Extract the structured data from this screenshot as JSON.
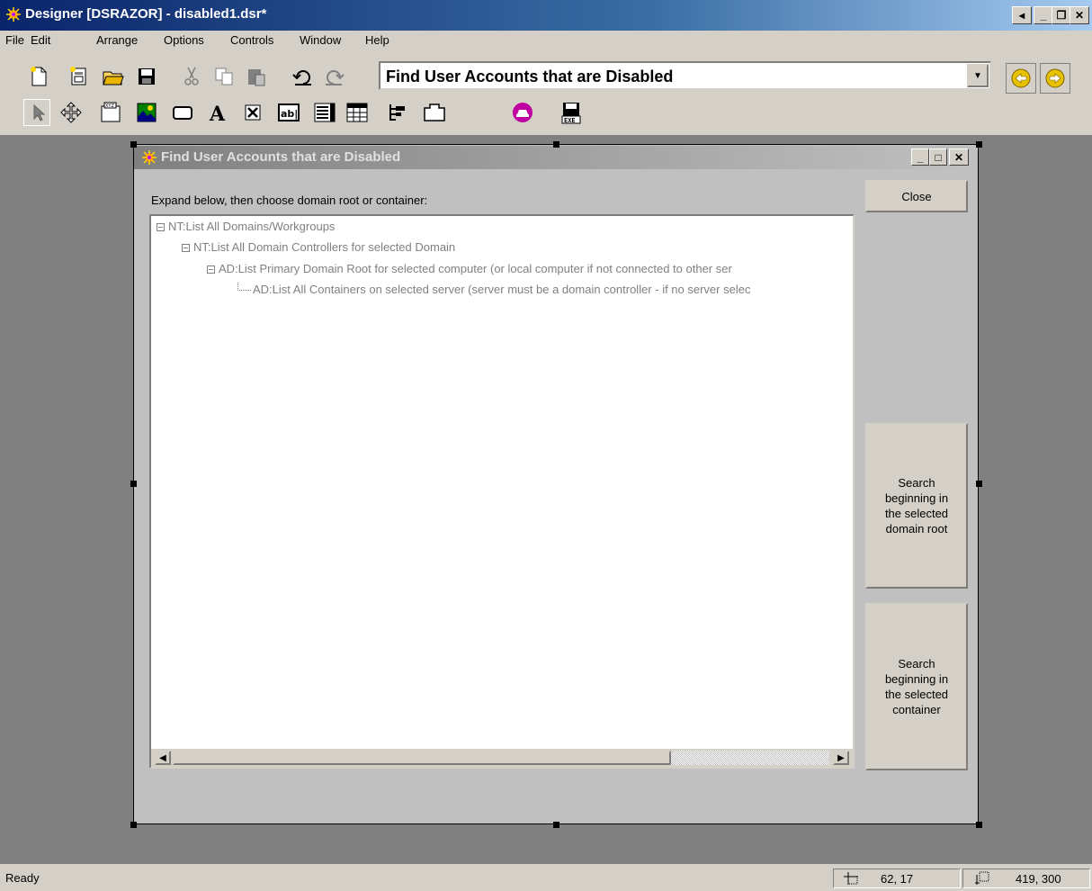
{
  "window": {
    "title": "Designer [DSRAZOR] - disabled1.dsr*",
    "app_icon": "designer-app-icon",
    "caption_buttons": [
      "restore-prev-icon",
      "minimize-icon",
      "maximize-icon",
      "close-icon"
    ]
  },
  "menu": {
    "items": [
      {
        "label": "File"
      },
      {
        "label": "Edit"
      },
      {
        "label": "Arrange"
      },
      {
        "label": "Options"
      },
      {
        "label": "Controls"
      },
      {
        "label": "Window"
      },
      {
        "label": "Help"
      }
    ]
  },
  "toolbar": {
    "row1_icons": [
      "new-file-icon",
      "new-template-icon",
      "open-folder-icon",
      "save-icon",
      "cut-icon",
      "copy-icon",
      "paste-icon",
      "undo-icon",
      "redo-icon"
    ],
    "form_combo_value": "Find User Accounts that are Disabled",
    "nav_icons": [
      "back-arrow-icon",
      "forward-arrow-icon"
    ],
    "row2_icons": [
      "pointer-icon",
      "move-icon",
      "frame-icon",
      "image-icon",
      "button-icon",
      "text-icon",
      "checkbox-icon",
      "edit-box-icon",
      "listbox-icon",
      "grid-icon",
      "treeview-icon",
      "tab-icon",
      "run-icon",
      "make-exe-icon"
    ]
  },
  "form": {
    "title": "Find User Accounts that are Disabled",
    "prompt": "Expand below, then choose domain root or container:",
    "tree_nodes": [
      {
        "label": "NT:List All Domains/Workgroups"
      },
      {
        "label": "NT:List All Domain Controllers for selected Domain"
      },
      {
        "label": "AD:List Primary Domain Root for selected computer (or local computer if not connected to other ser"
      },
      {
        "label": "AD:List All Containers on selected server (server must be a domain controller - if no server selec"
      }
    ],
    "close_button": "Close",
    "search_root_button": [
      "Search",
      "beginning in",
      "the selected",
      "domain root"
    ],
    "search_container_button": [
      "Search",
      "beginning in",
      "the selected",
      "container"
    ]
  },
  "status": {
    "text": "Ready",
    "position": "62, 17",
    "size": "419, 300"
  }
}
